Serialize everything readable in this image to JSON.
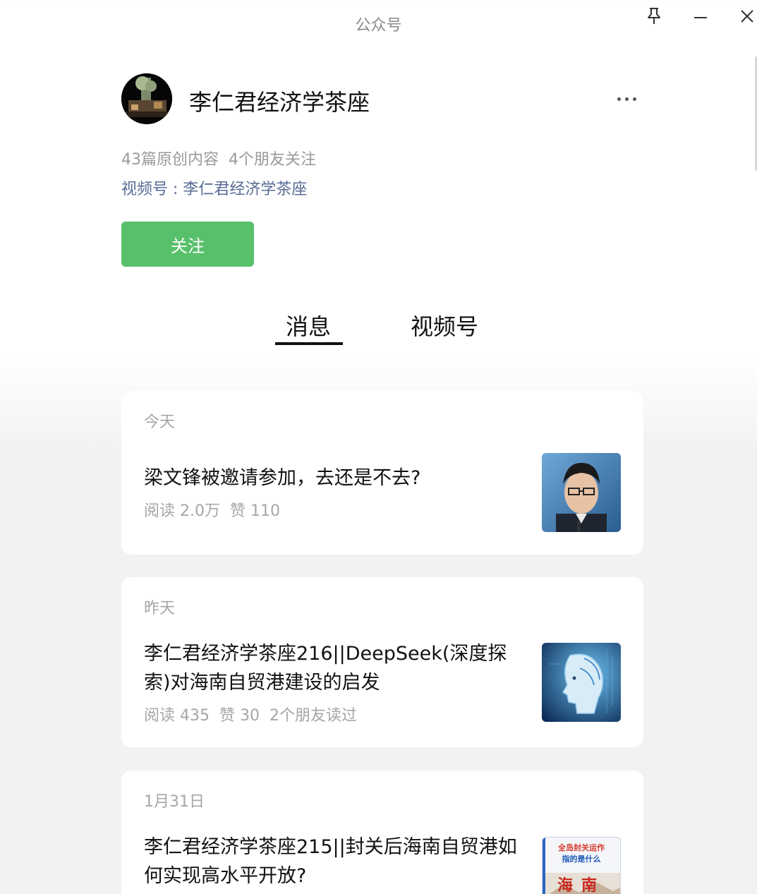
{
  "window": {
    "title": "公众号"
  },
  "profile": {
    "name": "李仁君经济学茶座",
    "original_count": "43篇原创内容",
    "friends_following": "4个朋友关注",
    "channel": "视频号 : 李仁君经济学茶座",
    "follow_label": "关注"
  },
  "tabs": [
    {
      "label": "消息",
      "active": true
    },
    {
      "label": "视频号",
      "active": false
    }
  ],
  "articles": [
    {
      "date": "今天",
      "title": "梁文锋被邀请参加，去还是不去?",
      "reads": "阅读 2.0万",
      "likes": "赞 110",
      "friends_read": ""
    },
    {
      "date": "昨天",
      "title": "李仁君经济学茶座216||DeepSeek(深度探索)对海南自贸港建设的启发",
      "reads": "阅读 435",
      "likes": "赞 30",
      "friends_read": "2个朋友读过"
    },
    {
      "date": "1月31日",
      "title": "李仁君经济学茶座215||封关后海南自贸港如何实现高水平开放?",
      "reads": "",
      "likes": "",
      "friends_read": "",
      "thumb_text": [
        "全岛封关运作",
        "指的是什么",
        "海南"
      ]
    }
  ],
  "colors": {
    "accent_green": "#58c06a",
    "link_blue": "#576b95",
    "muted_text": "#a6a6a6"
  }
}
